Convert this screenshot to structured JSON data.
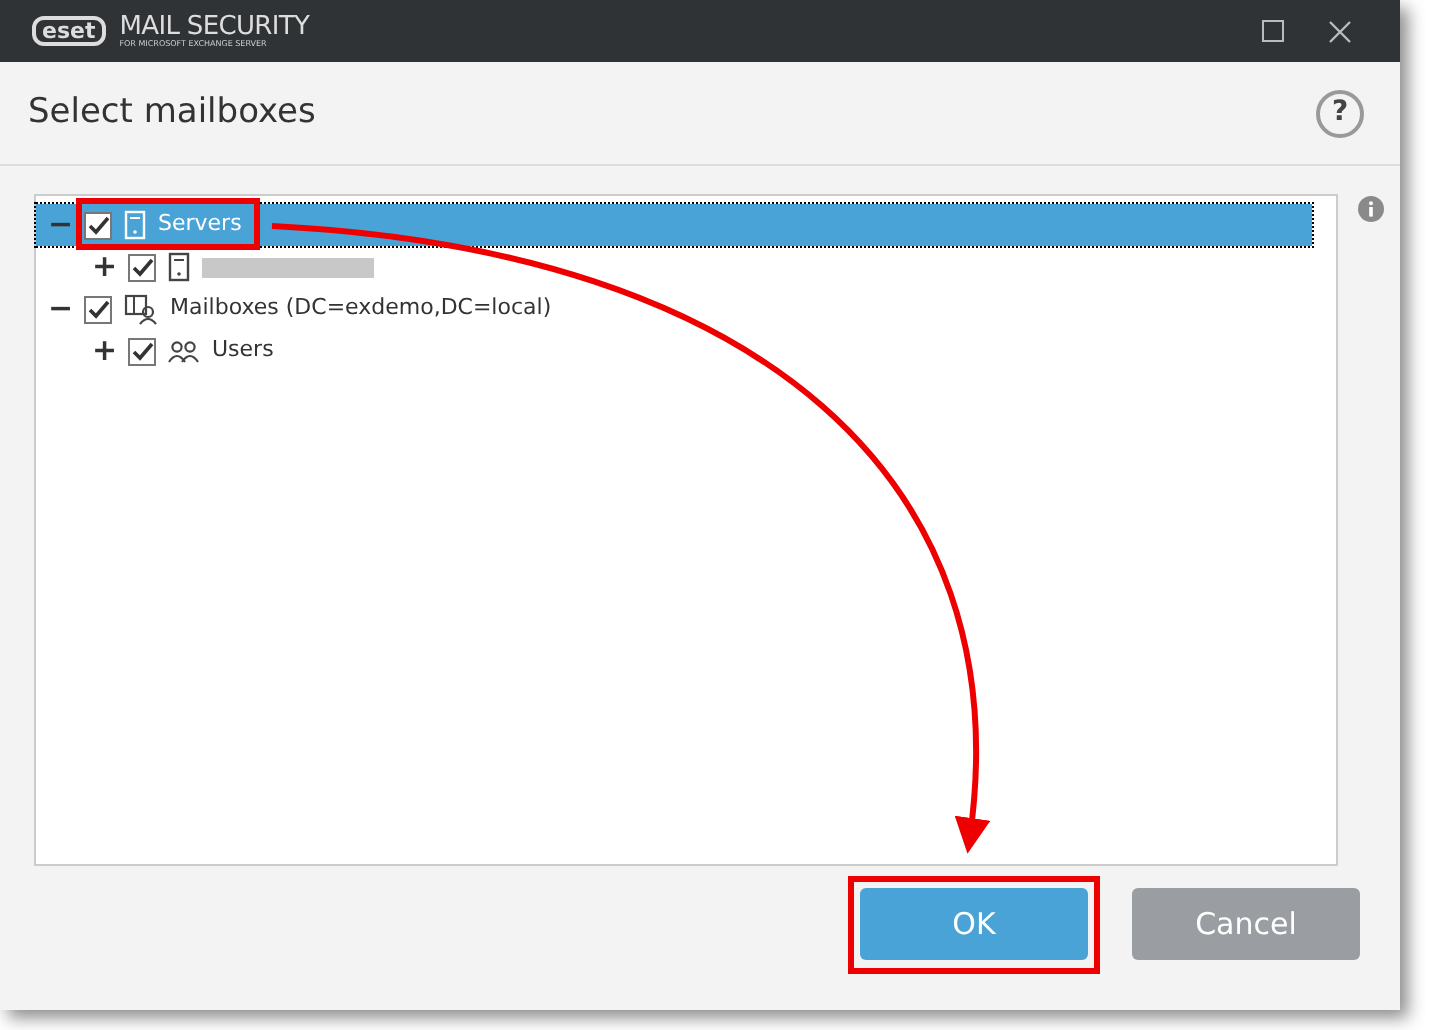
{
  "window": {
    "logo": "eset",
    "product": "MAIL SECURITY",
    "subtitle": "FOR MICROSOFT EXCHANGE SERVER",
    "title": "Select mailboxes"
  },
  "tree": [
    {
      "kind": "server",
      "label": "Servers",
      "expanded": true,
      "checked": true,
      "selected": true,
      "children": [
        {
          "kind": "server",
          "redacted": true,
          "expanded": false,
          "checked": true,
          "selected": false
        }
      ]
    },
    {
      "kind": "mailboxes",
      "label": "Mailboxes (DC=exdemo,DC=local)",
      "expanded": true,
      "checked": true,
      "selected": false,
      "children": [
        {
          "kind": "users",
          "label": "Users",
          "expanded": false,
          "checked": true,
          "selected": false
        }
      ]
    }
  ],
  "help": "?",
  "expander_open": "−",
  "expander_closed": "+",
  "buttons": [
    {
      "label": "OK",
      "kind": "primary"
    },
    {
      "label": "Cancel",
      "kind": "secondary"
    }
  ]
}
